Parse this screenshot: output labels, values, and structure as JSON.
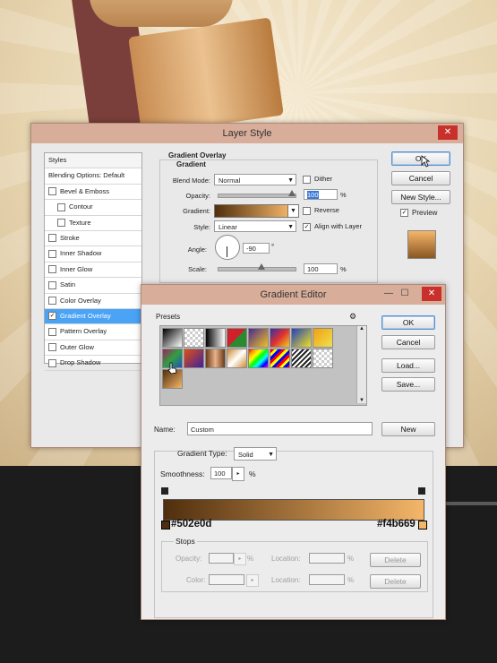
{
  "layer_style": {
    "title": "Layer Style",
    "close_label": "✕",
    "styles_panel": {
      "header": "Styles",
      "items": [
        {
          "label": "Blending Options: Default",
          "checkbox": false,
          "checked": false,
          "selected": false
        },
        {
          "label": "Bevel & Emboss",
          "checkbox": true,
          "checked": false,
          "selected": false
        },
        {
          "label": "Contour",
          "checkbox": true,
          "checked": false,
          "selected": false
        },
        {
          "label": "Texture",
          "checkbox": true,
          "checked": false,
          "selected": false
        },
        {
          "label": "Stroke",
          "checkbox": true,
          "checked": false,
          "selected": false
        },
        {
          "label": "Inner Shadow",
          "checkbox": true,
          "checked": false,
          "selected": false
        },
        {
          "label": "Inner Glow",
          "checkbox": true,
          "checked": false,
          "selected": false
        },
        {
          "label": "Satin",
          "checkbox": true,
          "checked": false,
          "selected": false
        },
        {
          "label": "Color Overlay",
          "checkbox": true,
          "checked": false,
          "selected": false
        },
        {
          "label": "Gradient Overlay",
          "checkbox": true,
          "checked": true,
          "selected": true
        },
        {
          "label": "Pattern Overlay",
          "checkbox": true,
          "checked": false,
          "selected": false
        },
        {
          "label": "Outer Glow",
          "checkbox": true,
          "checked": false,
          "selected": false
        },
        {
          "label": "Drop Shadow",
          "checkbox": true,
          "checked": false,
          "selected": false
        }
      ]
    },
    "gradient_overlay": {
      "section_title": "Gradient Overlay",
      "group_title": "Gradient",
      "blend_mode_label": "Blend Mode:",
      "blend_mode_value": "Normal",
      "dither_label": "Dither",
      "opacity_label": "Opacity:",
      "opacity_value": "100",
      "opacity_unit": "%",
      "gradient_label": "Gradient:",
      "reverse_label": "Reverse",
      "style_label": "Style:",
      "style_value": "Linear",
      "align_label": "Align with Layer",
      "angle_label": "Angle:",
      "angle_value": "-90",
      "angle_unit": "°",
      "scale_label": "Scale:",
      "scale_value": "100",
      "scale_unit": "%"
    },
    "buttons": {
      "ok": "OK",
      "cancel": "Cancel",
      "new_style": "New Style...",
      "preview": "Preview"
    }
  },
  "gradient_editor": {
    "title": "Gradient Editor",
    "minimize": "—",
    "maximize": "☐",
    "close": "✕",
    "presets_label": "Presets",
    "name_label": "Name:",
    "name_value": "Custom",
    "new_button": "New",
    "buttons": {
      "ok": "OK",
      "cancel": "Cancel",
      "load": "Load...",
      "save": "Save..."
    },
    "gradient_type_label": "Gradient Type:",
    "gradient_type_value": "Solid",
    "smoothness_label": "Smoothness:",
    "smoothness_value": "100",
    "smoothness_unit": "%",
    "stop_left_hex": "#502e0d",
    "stop_right_hex": "#f4b669",
    "stops": {
      "group_label": "Stops",
      "opacity_label": "Opacity:",
      "color_label": "Color:",
      "location_label": "Location:",
      "unit": "%",
      "delete_label": "Delete"
    }
  },
  "colors": {
    "gradient_start": "#502e0d",
    "gradient_end": "#f4b669",
    "selection_blue": "#4aa3f5",
    "title_bar": "#d8ad9a",
    "close_red": "#c9302c"
  }
}
